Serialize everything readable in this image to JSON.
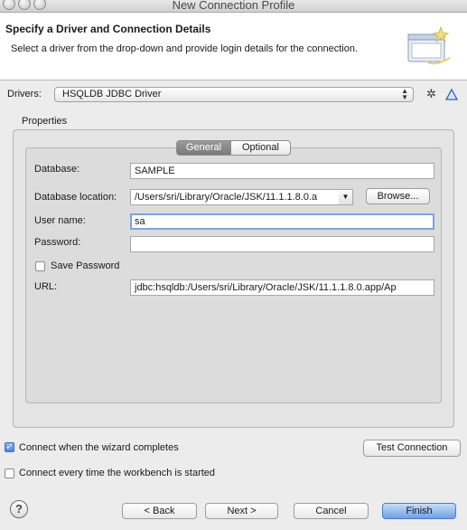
{
  "window": {
    "title": "New Connection Profile"
  },
  "header": {
    "title": "Specify a Driver and Connection Details",
    "description": "Select a driver from the drop-down and provide login details for the connection."
  },
  "drivers": {
    "label": "Drivers:",
    "selected": "HSQLDB JDBC Driver"
  },
  "properties": {
    "group_label": "Properties",
    "tabs": [
      "General",
      "Optional"
    ],
    "active_tab": "General",
    "database": {
      "label": "Database:",
      "value": "SAMPLE"
    },
    "location": {
      "label": "Database location:",
      "value": "/Users/sri/Library/Oracle/JSK/11.1.1.8.0.a",
      "browse": "Browse..."
    },
    "user": {
      "label": "User name:",
      "value": "sa"
    },
    "password": {
      "label": "Password:",
      "value": ""
    },
    "save_password": {
      "label": "Save Password",
      "checked": false
    },
    "url": {
      "label": "URL:",
      "value": "jdbc:hsqldb:/Users/sri/Library/Oracle/JSK/11.1.1.8.0.app/Ap"
    }
  },
  "options": {
    "connect_on_finish": {
      "label": "Connect when the wizard completes",
      "checked": true
    },
    "connect_every_time": {
      "label": "Connect every time the workbench is started",
      "checked": false
    },
    "test_connection": "Test Connection"
  },
  "footer": {
    "help": "?",
    "back": "< Back",
    "next": "Next >",
    "cancel": "Cancel",
    "finish": "Finish"
  }
}
